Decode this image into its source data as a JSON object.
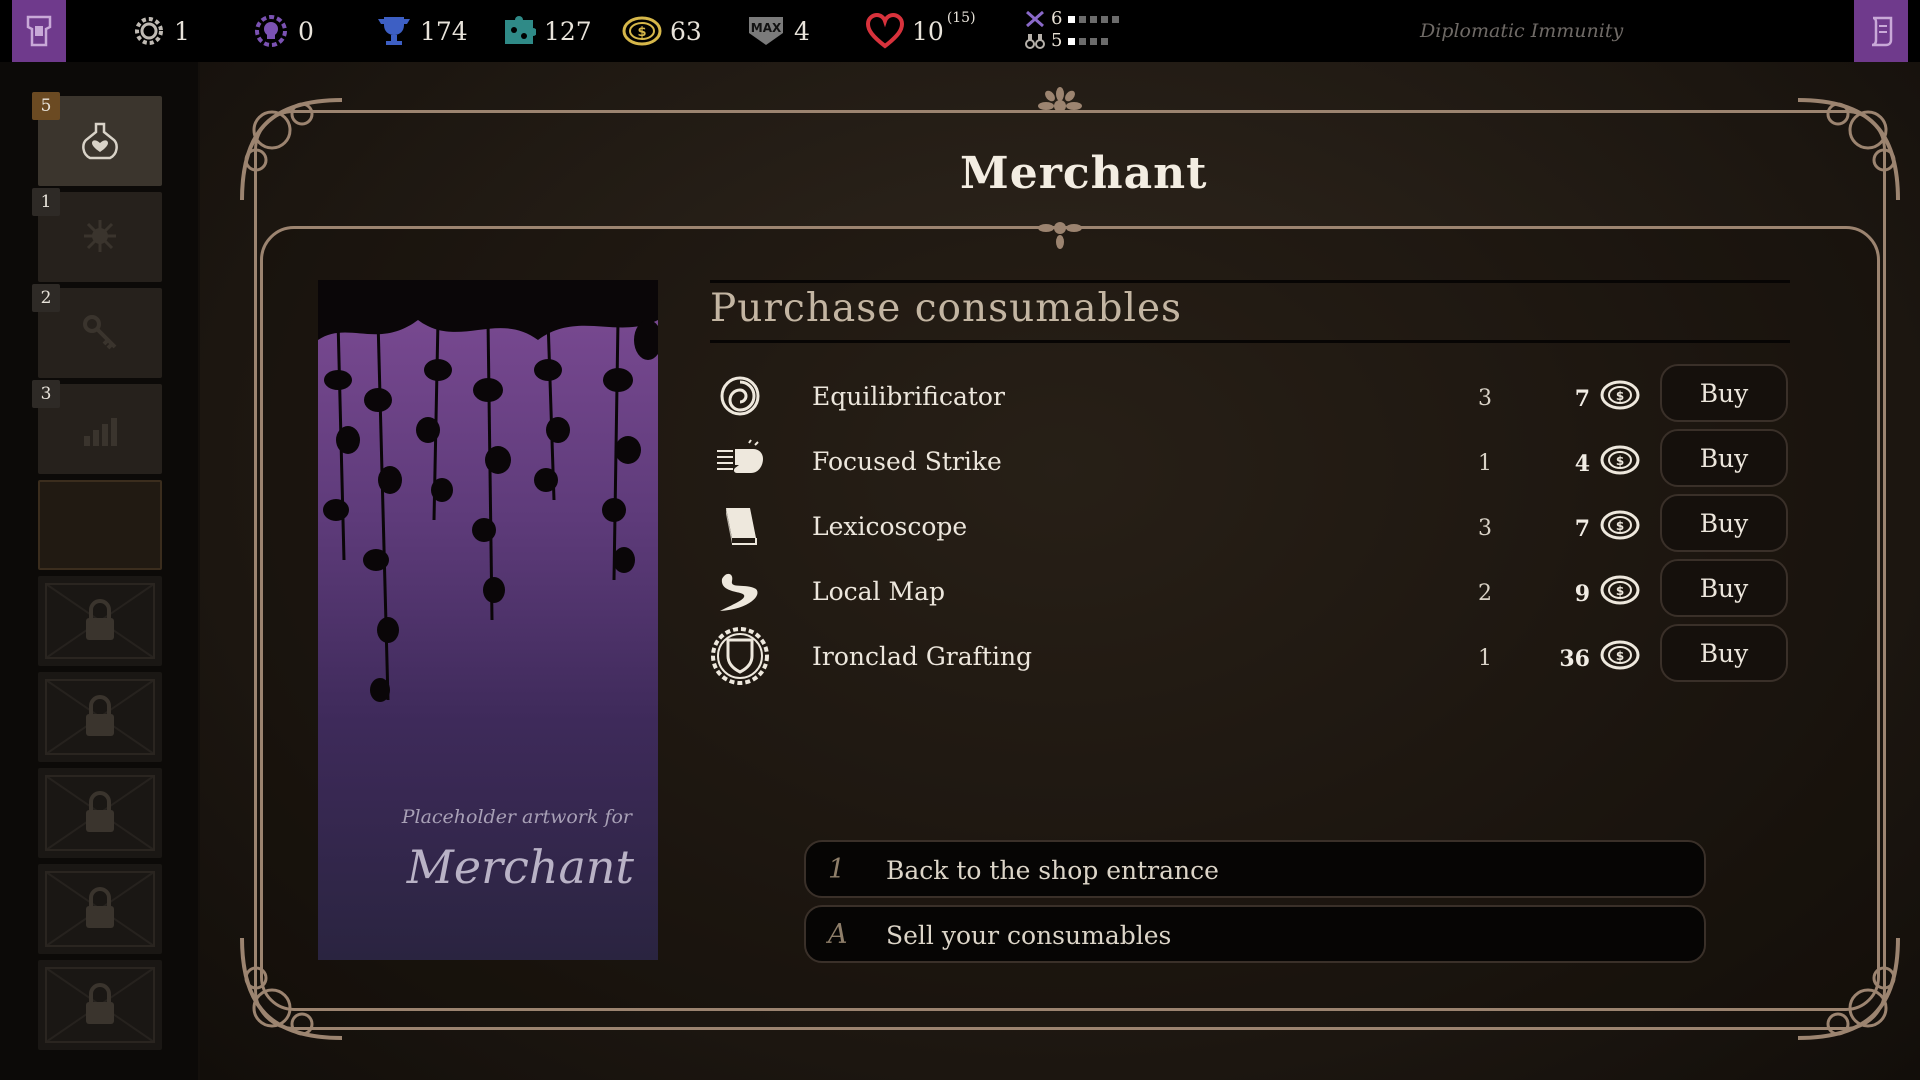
{
  "topbar": {
    "stats": [
      {
        "icon": "gear-icon",
        "value": "1"
      },
      {
        "icon": "skull-gear-icon",
        "value": "0"
      },
      {
        "icon": "trophy-icon",
        "value": "174"
      },
      {
        "icon": "puzzle-icon",
        "value": "127"
      },
      {
        "icon": "coin-icon",
        "value": "63"
      },
      {
        "icon": "max-shield-icon",
        "value": "4"
      },
      {
        "icon": "heart-icon",
        "value": "10",
        "max": "(15)"
      }
    ],
    "attack": {
      "icon": "crossed-swords-icon",
      "value": "6",
      "filled": 1,
      "total": 5
    },
    "defense": {
      "icon": "binoculars-icon",
      "value": "5",
      "filled": 1,
      "total": 4
    },
    "quest": "Diplomatic Immunity"
  },
  "sidebar": {
    "slots": [
      {
        "badge": "5",
        "icon": "potion-heart-icon",
        "state": "active"
      },
      {
        "badge": "1",
        "icon": "splat-icon",
        "state": "normal"
      },
      {
        "badge": "2",
        "icon": "key-icon",
        "state": "normal"
      },
      {
        "badge": "3",
        "icon": "bar-chart-icon",
        "state": "normal"
      },
      {
        "badge": "",
        "icon": "",
        "state": "empty"
      },
      {
        "badge": "",
        "icon": "lock-icon",
        "state": "locked"
      },
      {
        "badge": "",
        "icon": "lock-icon",
        "state": "locked"
      },
      {
        "badge": "",
        "icon": "lock-icon",
        "state": "locked"
      },
      {
        "badge": "",
        "icon": "lock-icon",
        "state": "locked"
      },
      {
        "badge": "",
        "icon": "lock-icon",
        "state": "locked"
      }
    ]
  },
  "panel": {
    "title": "Merchant",
    "art_caption_small": "Placeholder artwork for",
    "art_caption_big": "Merchant",
    "section_title": "Purchase consumables",
    "items": [
      {
        "icon": "spiral-icon",
        "name": "Equilibrificator",
        "stock": "3",
        "price": "7",
        "buy": "Buy"
      },
      {
        "icon": "fist-icon",
        "name": "Focused Strike",
        "stock": "1",
        "price": "4",
        "buy": "Buy"
      },
      {
        "icon": "book-icon",
        "name": "Lexicoscope",
        "stock": "3",
        "price": "7",
        "buy": "Buy"
      },
      {
        "icon": "road-icon",
        "name": "Local Map",
        "stock": "2",
        "price": "9",
        "buy": "Buy"
      },
      {
        "icon": "shield-cog-icon",
        "name": "Ironclad Grafting",
        "stock": "1",
        "price": "36",
        "buy": "Buy"
      }
    ],
    "options": [
      {
        "key": "1",
        "label": "Back to the shop entrance"
      },
      {
        "key": "A",
        "label": "Sell your consumables"
      }
    ]
  },
  "colors": {
    "banner": "#6f3a8c",
    "frame": "#9c8470",
    "badge_active": "#6b4a22"
  }
}
